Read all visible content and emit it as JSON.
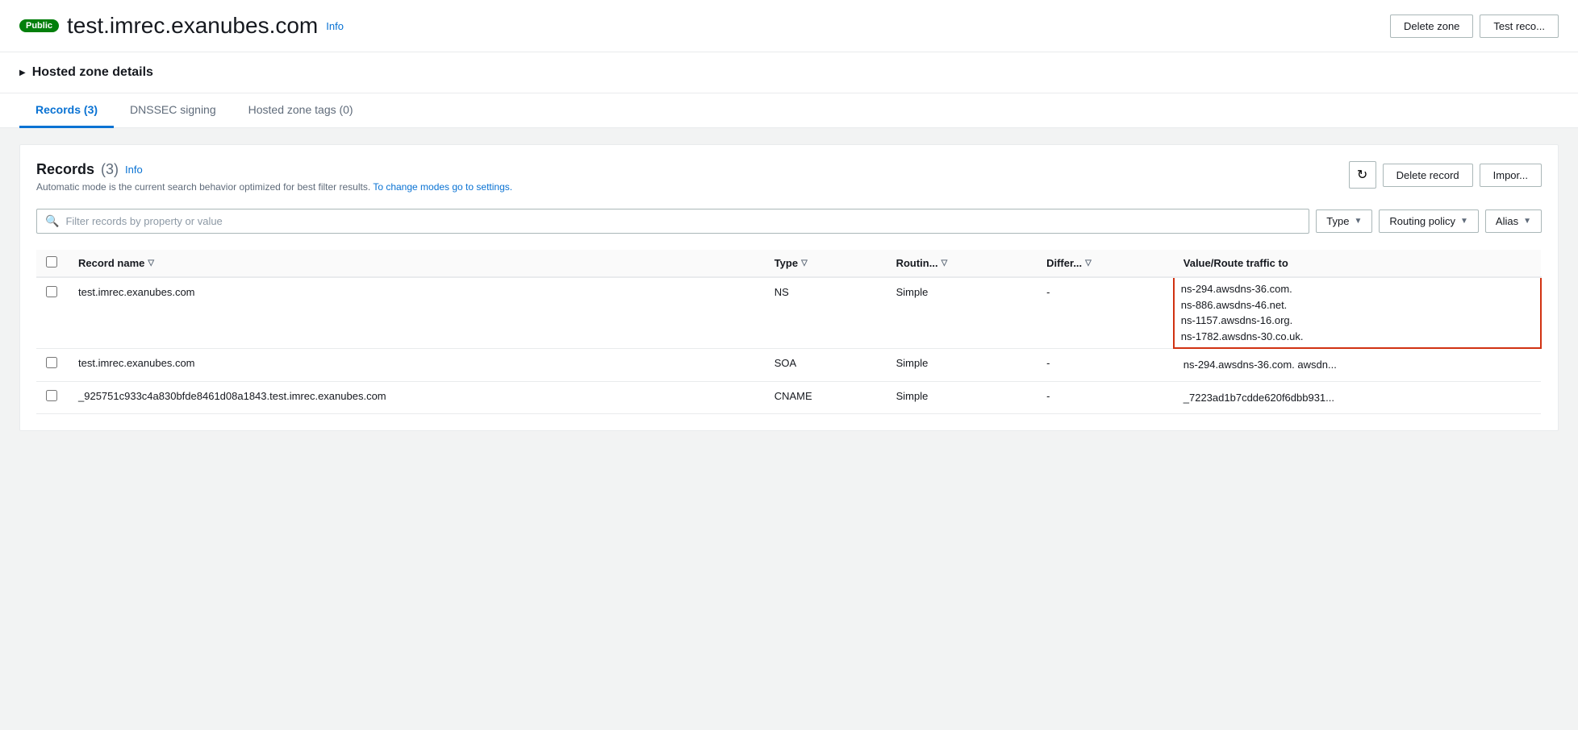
{
  "page": {
    "badge": "Public",
    "title": "test.imrec.exanubes.com",
    "info_label": "Info",
    "buttons": {
      "delete_zone": "Delete zone",
      "test_record": "Test reco..."
    }
  },
  "hosted_zone": {
    "title": "Hosted zone details",
    "chevron": "▶"
  },
  "tabs": [
    {
      "id": "records",
      "label": "Records (3)",
      "active": true
    },
    {
      "id": "dnssec",
      "label": "DNSSEC signing",
      "active": false
    },
    {
      "id": "tags",
      "label": "Hosted zone tags (0)",
      "active": false
    }
  ],
  "records_panel": {
    "title": "Records",
    "count": "(3)",
    "info_label": "Info",
    "auto_mode_text": "Automatic mode is the current search behavior optimized for best filter results.",
    "change_modes_link": "To change modes go to settings.",
    "filter_placeholder": "Filter records by property or value",
    "dropdowns": {
      "type": "Type",
      "routing_policy": "Routing policy",
      "alias": "Alias"
    },
    "refresh_icon": "↻",
    "delete_record_label": "Delete record",
    "import_label": "Impor..."
  },
  "table": {
    "columns": [
      {
        "id": "checkbox",
        "label": ""
      },
      {
        "id": "record_name",
        "label": "Record name",
        "sortable": true
      },
      {
        "id": "type",
        "label": "Type",
        "sortable": true
      },
      {
        "id": "routing",
        "label": "Routin...",
        "sortable": true
      },
      {
        "id": "differ",
        "label": "Differ...",
        "sortable": true
      },
      {
        "id": "value",
        "label": "Value/Route traffic to"
      }
    ],
    "rows": [
      {
        "id": 1,
        "record_name": "test.imrec.exanubes.com",
        "type": "NS",
        "routing": "Simple",
        "differ": "-",
        "value": "ns-294.awsdns-36.com.\nns-886.awsdns-46.net.\nns-1157.awsdns-16.org.\nns-1782.awsdns-30.co.uk.",
        "value_lines": [
          "ns-294.awsdns-36.com.",
          "ns-886.awsdns-46.net.",
          "ns-1157.awsdns-16.org.",
          "ns-1782.awsdns-30.co.uk."
        ],
        "highlighted": true
      },
      {
        "id": 2,
        "record_name": "test.imrec.exanubes.com",
        "type": "SOA",
        "routing": "Simple",
        "differ": "-",
        "value": "ns-294.awsdns-36.com. awsdn...",
        "value_lines": [
          "ns-294.awsdns-36.com. awsdn..."
        ],
        "highlighted": false
      },
      {
        "id": 3,
        "record_name": "_925751c933c4a830bfde8461d08a1843.test.imrec.exanubes.com",
        "type": "CNAME",
        "routing": "Simple",
        "differ": "-",
        "value": "_7223ad1b7cdde620f6dbb931...",
        "value_lines": [
          "_7223ad1b7cdde620f6dbb931..."
        ],
        "highlighted": false
      }
    ]
  },
  "colors": {
    "active_tab": "#0972d3",
    "highlight_border": "#d13212",
    "link": "#0972d3"
  }
}
